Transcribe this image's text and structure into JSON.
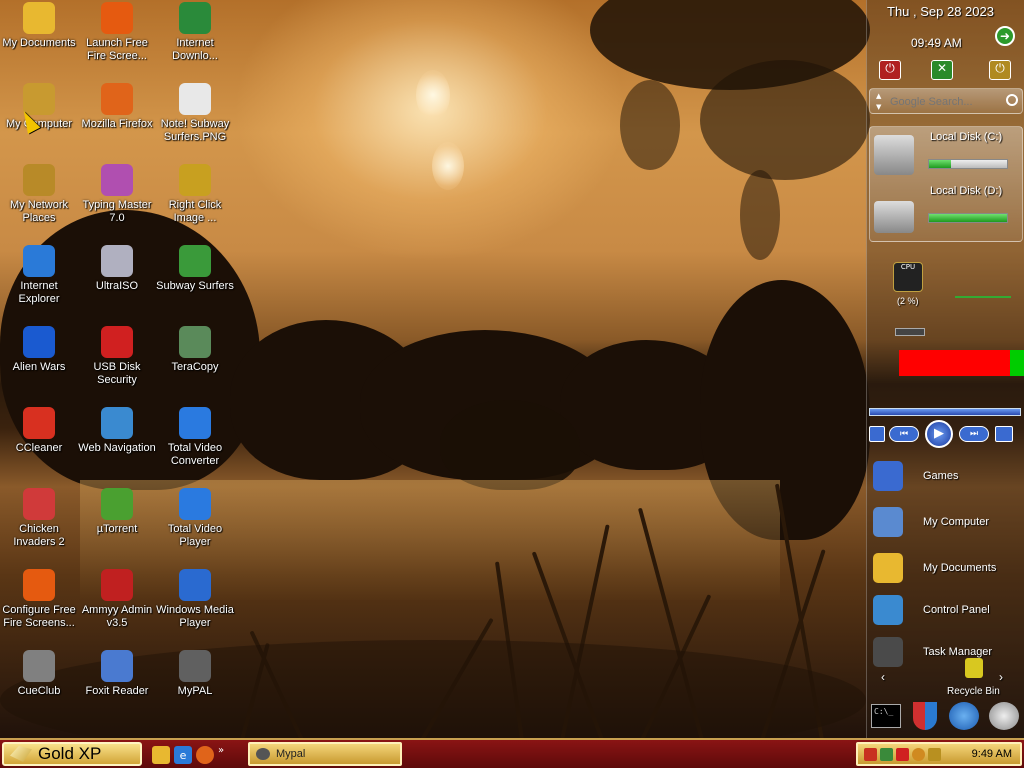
{
  "desktop": {
    "icons": [
      {
        "label": "My Documents",
        "icon": "folder-icon",
        "color": "#e8b830"
      },
      {
        "label": "Launch Free Fire Scree...",
        "icon": "flame-icon",
        "color": "#e55a10"
      },
      {
        "label": "Internet Downlo...",
        "icon": "idm-icon",
        "color": "#2a8a3a"
      },
      {
        "label": "My Computer",
        "icon": "computer-icon",
        "color": "#c89a30"
      },
      {
        "label": "Mozilla Firefox",
        "icon": "firefox-icon",
        "color": "#e0641a"
      },
      {
        "label": "Note! Subway Surfers.PNG",
        "icon": "image-file-icon",
        "color": "#e8e8e8"
      },
      {
        "label": "My Network Places",
        "icon": "network-icon",
        "color": "#b88a28"
      },
      {
        "label": "Typing Master 7.0",
        "icon": "typing-master-icon",
        "color": "#b04fb0"
      },
      {
        "label": "Right Click Image ...",
        "icon": "gear-icon",
        "color": "#c8a020"
      },
      {
        "label": "Internet Explorer",
        "icon": "ie-icon",
        "color": "#2a7ad8"
      },
      {
        "label": "UltraISO",
        "icon": "disc-icon",
        "color": "#b0b0c0"
      },
      {
        "label": "Subway Surfers",
        "icon": "subway-surfers-icon",
        "color": "#3a9a3a"
      },
      {
        "label": "Alien Wars",
        "icon": "alien-wars-icon",
        "color": "#1a5ad0"
      },
      {
        "label": "USB Disk Security",
        "icon": "shield-icon",
        "color": "#d02020"
      },
      {
        "label": "TeraCopy",
        "icon": "teracopy-icon",
        "color": "#5a8a5a"
      },
      {
        "label": "CCleaner",
        "icon": "ccleaner-icon",
        "color": "#d83020"
      },
      {
        "label": "Web Navigation",
        "icon": "globe-icon",
        "color": "#3a8ad0"
      },
      {
        "label": "Total Video Converter",
        "icon": "converter-icon",
        "color": "#2a7ae0"
      },
      {
        "label": "Chicken Invaders 2",
        "icon": "chicken-icon",
        "color": "#d03a3a"
      },
      {
        "label": "µTorrent",
        "icon": "utorrent-icon",
        "color": "#4aa030"
      },
      {
        "label": "Total Video Player",
        "icon": "play-icon",
        "color": "#2a7ae0"
      },
      {
        "label": "Configure Free Fire Screens...",
        "icon": "flame-icon",
        "color": "#e55a10"
      },
      {
        "label": "Ammyy Admin v3.5",
        "icon": "ammyy-icon",
        "color": "#c02020"
      },
      {
        "label": "Windows Media Player",
        "icon": "media-player-icon",
        "color": "#2a6ad0"
      },
      {
        "label": "CueClub",
        "icon": "cueclub-icon",
        "color": "#808080"
      },
      {
        "label": "Foxit Reader",
        "icon": "foxit-icon",
        "color": "#4a7ad0"
      },
      {
        "label": "MyPAL",
        "icon": "mypal-icon",
        "color": "#606060"
      }
    ]
  },
  "sidebar": {
    "date": "Thu , Sep 28 2023",
    "time": "09:49 AM",
    "search_placeholder": "Google Search...",
    "disks": [
      {
        "label": "Local Disk (C:)",
        "used": 0.28
      },
      {
        "label": "Local Disk (D:)",
        "used": 1.0
      }
    ],
    "cpu_label": "CPU",
    "cpu_percent": "(2 %)",
    "ram_bar": {
      "used": 0.88
    },
    "items": [
      {
        "label": "Games",
        "icon": "games-folder-icon"
      },
      {
        "label": "My Computer",
        "icon": "computer-icon"
      },
      {
        "label": "My Documents",
        "icon": "folder-icon"
      },
      {
        "label": "Control Panel",
        "icon": "control-panel-icon"
      },
      {
        "label": "Task Manager",
        "icon": "task-manager-icon"
      }
    ],
    "recycle_bin": "Recycle Bin"
  },
  "taskbar": {
    "start_label": "Gold XP",
    "task_button_label": "Mypal",
    "clock": "9:49 AM",
    "chevron": "»"
  },
  "colors": {
    "taskbar": "#7a1010",
    "gold": "#e0b84a"
  }
}
